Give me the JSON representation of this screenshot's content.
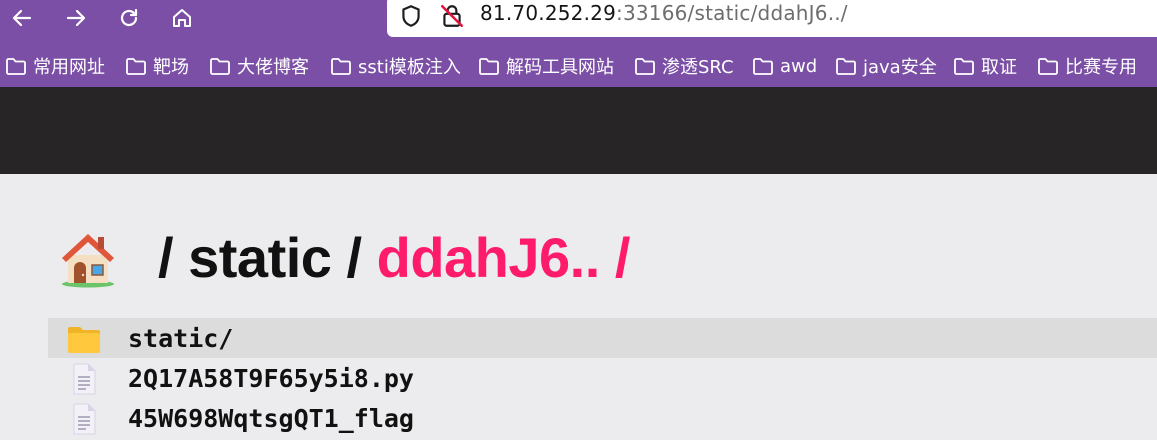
{
  "browser": {
    "nav": {
      "back_icon": "arrow-left-icon",
      "forward_icon": "arrow-right-icon",
      "reload_icon": "reload-icon",
      "home_icon": "home-icon"
    },
    "url": {
      "host": "81.70.252.29",
      "path": ":33166/static/ddahJ6../",
      "security_icon": "shield-icon",
      "insecure_icon": "insecure-lock-icon"
    },
    "bookmarks": [
      {
        "label": "常用网址"
      },
      {
        "label": "靶场"
      },
      {
        "label": "大佬博客"
      },
      {
        "label": "ssti模板注入"
      },
      {
        "label": "解码工具网站"
      },
      {
        "label": "渗透SRC"
      },
      {
        "label": "awd"
      },
      {
        "label": "java安全"
      },
      {
        "label": "取证"
      },
      {
        "label": "比赛专用"
      }
    ],
    "colors": {
      "chrome": "#7b4fa6",
      "banner": "#282526",
      "accent": "#ff1b6b"
    }
  },
  "page": {
    "breadcrumb": {
      "sep": "/",
      "static": "static",
      "current": "ddahJ6..",
      "trailing": "/"
    },
    "files": [
      {
        "name": "static/",
        "type": "folder",
        "icon": "folder-icon"
      },
      {
        "name": "2Q17A58T9F65y5i8.py",
        "type": "file",
        "icon": "file-icon"
      },
      {
        "name": "45W698WqtsgQT1_flag",
        "type": "file",
        "icon": "file-icon"
      }
    ]
  }
}
